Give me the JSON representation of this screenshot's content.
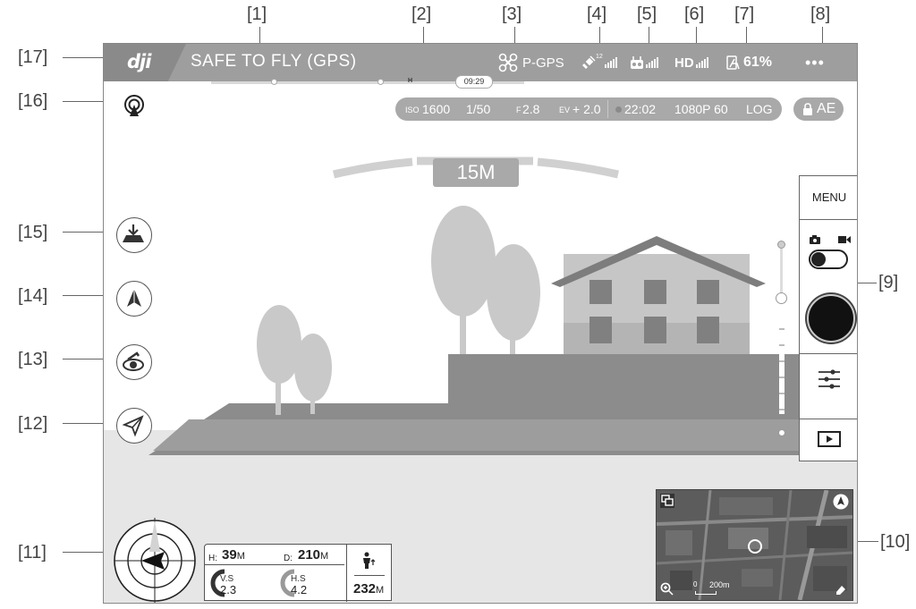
{
  "callouts": [
    "[1]",
    "[2]",
    "[3]",
    "[4]",
    "[5]",
    "[6]",
    "[7]",
    "[8]",
    "[9]",
    "[10]",
    "[11]",
    "[12]",
    "[13]",
    "[14]",
    "[15]",
    "[16]",
    "[17]"
  ],
  "topbar": {
    "logo": "dji",
    "status": "SAFE TO FLY (GPS)",
    "flight_mode": "P-GPS",
    "gps_count": "12",
    "hd_label": "HD",
    "battery": "61%",
    "more": "•••"
  },
  "timeline": {
    "time": "09:29",
    "home_marker": "H"
  },
  "camera_params": {
    "iso_label": "ISO",
    "iso": "1600",
    "shutter": "1/50",
    "aperture_label": "F",
    "aperture": "2.8",
    "ev_label": "EV",
    "ev": "+ 2.0",
    "record_time": "22:02",
    "resolution": "1080P 60",
    "color_profile": "LOG",
    "ae": "AE"
  },
  "view": {
    "distance": "15M"
  },
  "right_panel": {
    "menu": "MENU"
  },
  "telemetry": {
    "h_label": "H:",
    "h_value": "39",
    "h_unit": "M",
    "d_label": "D:",
    "d_value": "210",
    "d_unit": "M",
    "vs_label": "V.S",
    "vs_value": "2.3",
    "hs_label": "H.S",
    "hs_value": "4.2",
    "dist_value": "232",
    "dist_unit": "M"
  },
  "minimap": {
    "scale_zero": "0",
    "scale_label": "200m"
  },
  "icons": [
    "dji-logo",
    "aircraft-icon",
    "satellite-icon",
    "remote-controller-icon",
    "hd-signal-icon",
    "battery-icon",
    "more-icon",
    "obstacle-sensing-icon",
    "auto-takeoff-icon",
    "return-to-home-icon",
    "intelligent-flight-icon",
    "track-icon",
    "photo-icon",
    "video-icon",
    "settings-sliders-icon",
    "playback-icon",
    "map-switch-icon",
    "map-zoom-icon",
    "compass-icon",
    "person-icon"
  ],
  "colors": {
    "bar": "#9e9e9e",
    "pill": "#a9a9a9",
    "scene": "#8e8e8e"
  }
}
